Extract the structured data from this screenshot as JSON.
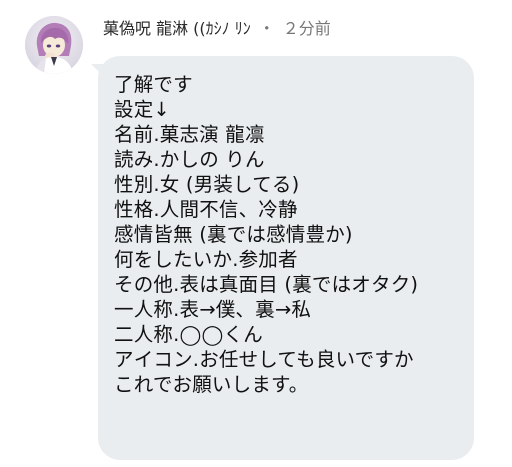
{
  "message": {
    "user_name": "菓偽呪 龍淋 ((ｶｼﾉ ﾘﾝ",
    "separator": "・",
    "timestamp": "２分前",
    "lines": [
      "了解です",
      "設定↓",
      "名前.菓志演 龍凛",
      "読み.かしの りん",
      "性別.女 (男装してる)",
      "性格.人間不信、冷静",
      "感情皆無 (裏では感情豊か)",
      "何をしたいか.参加者",
      "その他.表は真面目 (裏ではオタク)",
      "一人称.表→僕、裏→私",
      "二人称.◯◯くん",
      "アイコン.お任せしても良いですか",
      "これでお願いします。"
    ]
  },
  "colors": {
    "bubble_bg": "#eaedef",
    "text": "#111111",
    "meta_text": "#777777"
  },
  "icons": {
    "avatar": "user-avatar-anime-portrait"
  }
}
